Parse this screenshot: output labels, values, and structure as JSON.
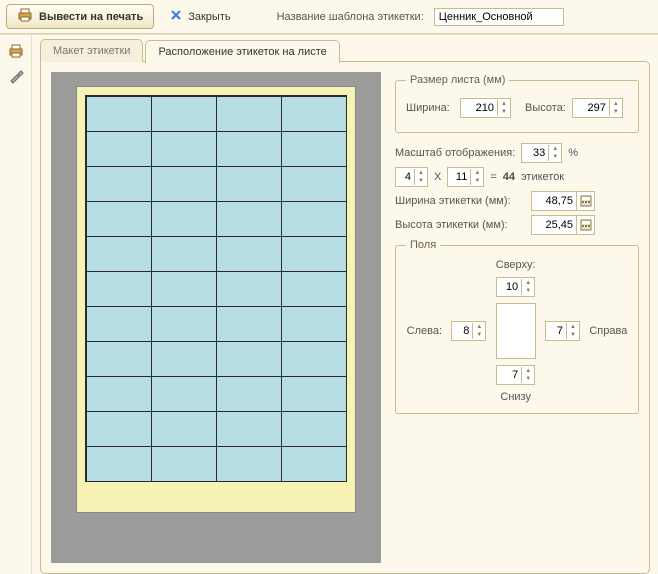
{
  "toolbar": {
    "print_label": "Вывести на печать",
    "close_label": "Закрыть",
    "template_caption": "Название шаблона этикетки:",
    "template_value": "Ценник_Основной"
  },
  "tabs": {
    "layout": "Макет этикетки",
    "placement": "Расположение этикеток на листе"
  },
  "sheet_size": {
    "legend": "Размер листа (мм)",
    "width_label": "Ширина:",
    "width_value": "210",
    "height_label": "Высота:",
    "height_value": "297"
  },
  "scale": {
    "label": "Масштаб отображения:",
    "value": "33",
    "percent": "%"
  },
  "grid": {
    "cols": "4",
    "x": "X",
    "rows": "11",
    "eq": "=",
    "total": "44",
    "unit": "этикеток"
  },
  "label_w": {
    "label": "Ширина этикетки (мм):",
    "value": "48,75"
  },
  "label_h": {
    "label": "Высота этикетки (мм):",
    "value": "25,45"
  },
  "margins": {
    "legend": "Поля",
    "top_label": "Сверху:",
    "top_value": "10",
    "left_label": "Слева:",
    "left_value": "8",
    "right_label": "Справа",
    "right_value": "7",
    "bottom_label": "Снизу",
    "bottom_value": "7"
  }
}
